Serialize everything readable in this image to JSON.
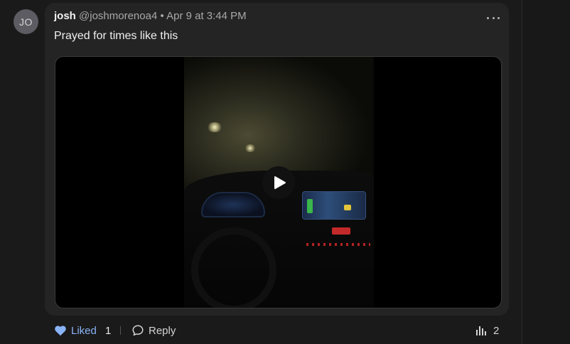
{
  "post": {
    "avatar_initials": "JO",
    "author_name": "josh",
    "author_handle": "@joshmorenoa4",
    "separator": "•",
    "timestamp": "Apr 9 at 3:44 PM",
    "text": "Prayed for times like this",
    "more_icon": "more-horizontal-icon"
  },
  "media": {
    "type": "video",
    "play_icon": "play-icon"
  },
  "actions": {
    "liked_label": "Liked",
    "like_count": "1",
    "reply_label": "Reply",
    "stats_count": "2",
    "heart_icon": "heart-icon",
    "reply_icon": "speech-bubble-icon",
    "stats_icon": "bar-chart-icon"
  },
  "colors": {
    "liked_accent": "#8ab4f8",
    "background": "#1a1a1a",
    "card": "#242424"
  }
}
